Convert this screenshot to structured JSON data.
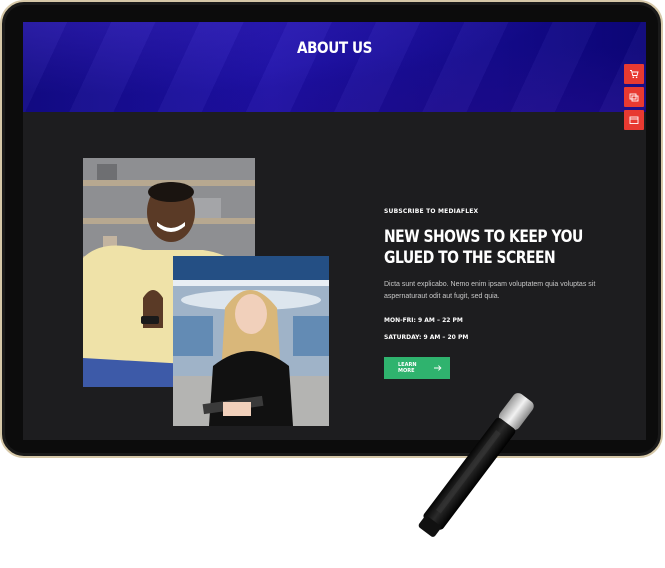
{
  "header": {
    "title": "ABOUT US"
  },
  "side_icons": [
    {
      "name": "cart-icon"
    },
    {
      "name": "layers-icon"
    },
    {
      "name": "window-icon"
    }
  ],
  "about": {
    "eyebrow": "SUBSCRIBE TO MEDIAFLEX",
    "headline_line1": "NEW SHOWS TO KEEP YOU",
    "headline_line2": "GLUED TO THE SCREEN",
    "description": "Dicta sunt explicabo. Nemo enim ipsam voluptatem quia voluptas sit aspernaturaut odit aut fugit, sed quia.",
    "hours_weekday": "MON-FRI: 9 AM – 22 PM",
    "hours_saturday": "SATURDAY: 9 AM – 20 PM",
    "cta_label": "LEARN MORE"
  },
  "colors": {
    "accent_red": "#e83a31",
    "cta_green": "#2fb36e",
    "hero_blue": "#1e11a8",
    "bezel_gold": "#d6c8a8"
  }
}
